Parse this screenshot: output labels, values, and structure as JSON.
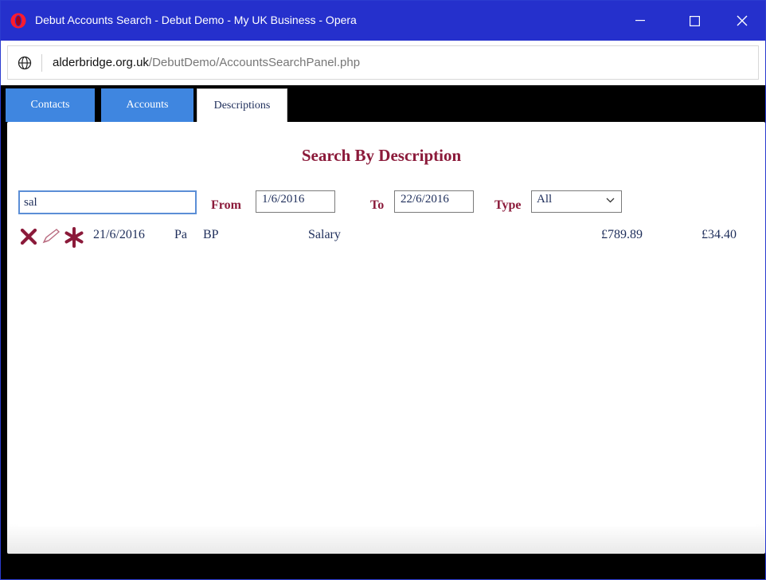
{
  "window": {
    "title": "Debut Accounts Search - Debut Demo - My UK Business - Opera",
    "accent_color": "#2530cc"
  },
  "address_bar": {
    "host": "alderbridge.org.uk",
    "path": "/DebutDemo/AccountsSearchPanel.php"
  },
  "tabs": [
    {
      "label": "Contacts",
      "active": false
    },
    {
      "label": "Accounts",
      "active": false
    },
    {
      "label": "Descriptions",
      "active": true
    }
  ],
  "search": {
    "heading": "Search By Description",
    "query": "sal",
    "from_label": "From",
    "from_value": "1/6/2016",
    "to_label": "To",
    "to_value": "22/6/2016",
    "type_label": "Type",
    "type_value": "All"
  },
  "results": [
    {
      "date": "21/6/2016",
      "code": "Pa",
      "account": "BP",
      "description": "Salary",
      "amount": "£789.89",
      "amount2": "£34.40"
    }
  ],
  "icons": {
    "delete": "delete-x-icon",
    "edit": "pencil-icon",
    "flag": "asterisk-icon"
  },
  "colors": {
    "heading": "#8b1a3a",
    "text": "#1d2d5a",
    "tab_blue": "#3f86e0"
  }
}
